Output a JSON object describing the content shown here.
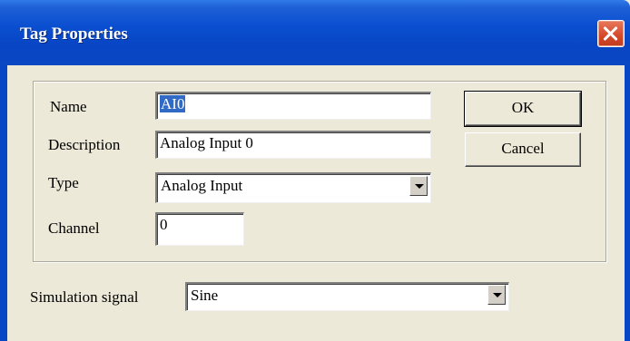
{
  "dialog": {
    "title": "Tag Properties"
  },
  "fields": {
    "name_label": "Name",
    "name_value": "AI0",
    "description_label": "Description",
    "description_value": "Analog Input 0",
    "type_label": "Type",
    "type_value": "Analog Input",
    "channel_label": "Channel",
    "channel_value": "0"
  },
  "simulation": {
    "label": "Simulation signal",
    "value": "Sine"
  },
  "buttons": {
    "ok_label": "OK",
    "cancel_label": "Cancel"
  },
  "colors": {
    "titlebar": "#0a47c3",
    "dialog_bg": "#ece9d8",
    "selection": "#316ac5",
    "close_button": "#d5482a"
  },
  "icons": {
    "close": "close-icon",
    "dropdown": "chevron-down-icon"
  }
}
